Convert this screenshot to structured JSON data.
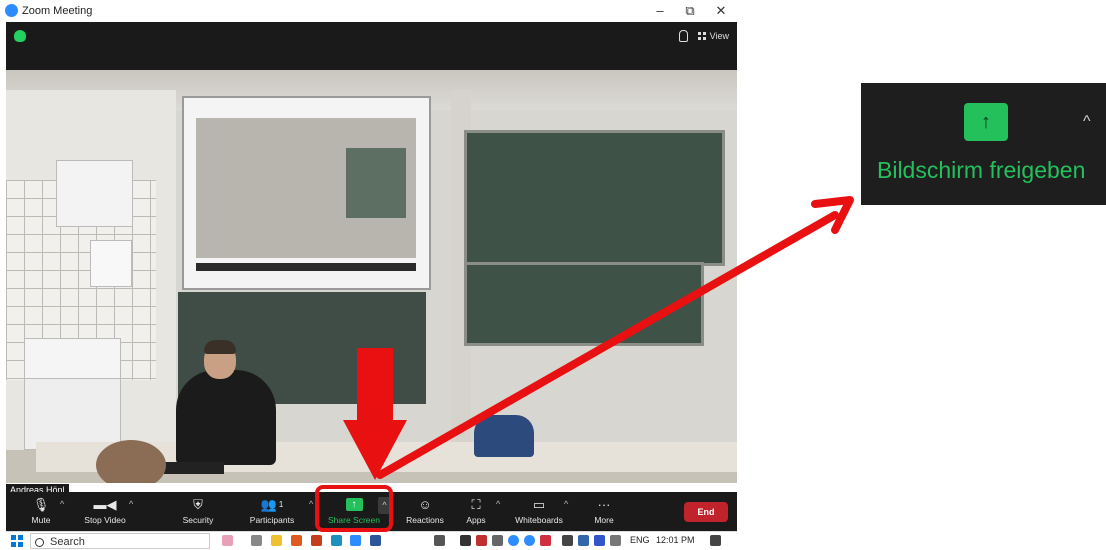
{
  "window": {
    "title": "Zoom Meeting",
    "minimize": "–",
    "restore": "⧉",
    "close": "✕"
  },
  "topbar": {
    "view_label": "View"
  },
  "participant_name": "Andreas Hönl",
  "toolbar": {
    "mute": "Mute",
    "stop_video": "Stop Video",
    "security": "Security",
    "participants": "Participants",
    "participants_count": "1",
    "share_screen": "Share Screen",
    "reactions": "Reactions",
    "apps": "Apps",
    "whiteboards": "Whiteboards",
    "more": "More",
    "end": "End"
  },
  "taskbar": {
    "search_placeholder": "Search",
    "language": "ENG",
    "time": "12:01 PM"
  },
  "callout": {
    "label": "Bildschirm freigeben"
  },
  "colors": {
    "share_green": "#23c05c",
    "end_red": "#c0232c",
    "annotation_red": "#e81010"
  }
}
